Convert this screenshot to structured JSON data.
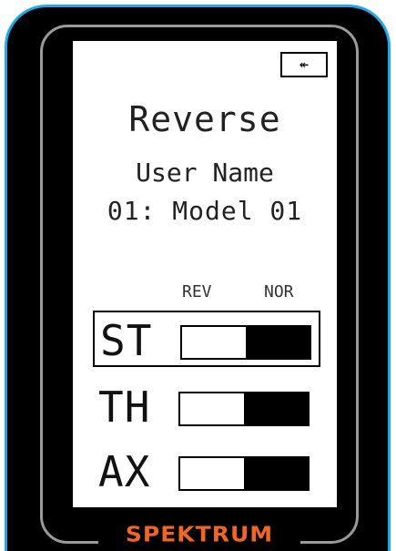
{
  "brand": "SPEKTRUM",
  "screen": {
    "back_icon": "↞",
    "title": "Reverse",
    "user_name": "User Name",
    "model": "01: Model 01",
    "columns": {
      "rev": "REV",
      "nor": "NOR"
    },
    "channels": [
      {
        "label": "ST",
        "state": "NOR",
        "selected": true
      },
      {
        "label": "TH",
        "state": "NOR",
        "selected": false
      },
      {
        "label": "AX",
        "state": "NOR",
        "selected": false
      }
    ]
  },
  "colors": {
    "brand": "#f26522",
    "bezel_edge": "#1fa8ee",
    "frame": "#9a9a9a"
  }
}
